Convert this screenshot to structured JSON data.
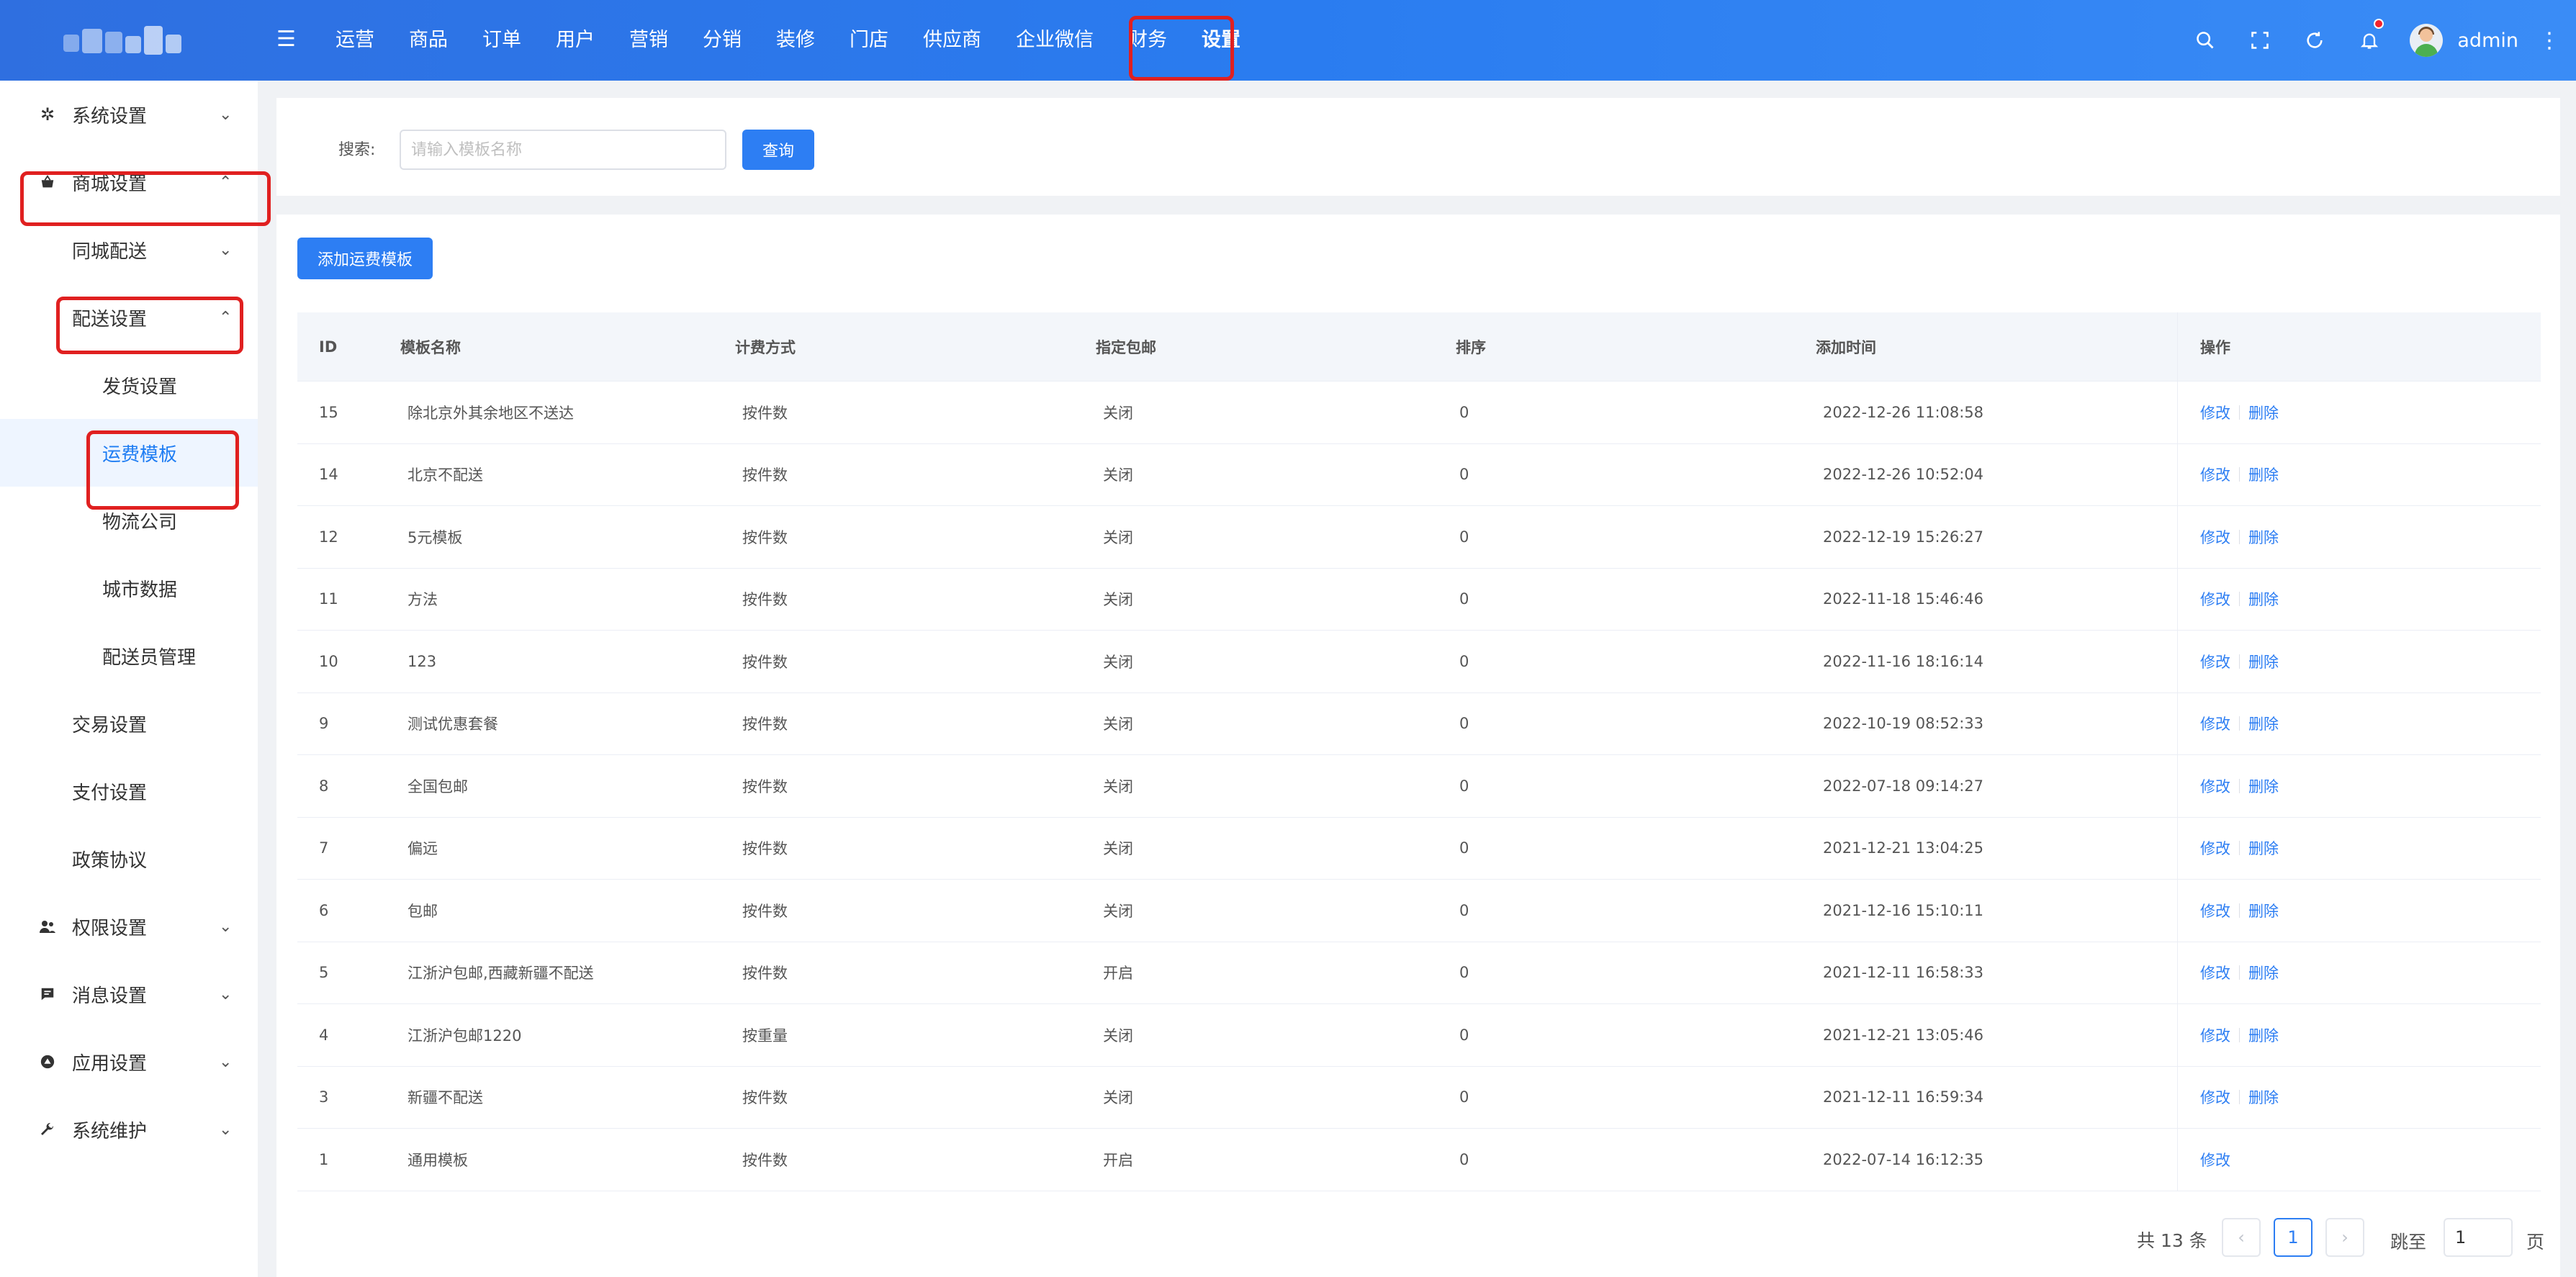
{
  "header": {
    "nav": [
      "运营",
      "商品",
      "订单",
      "用户",
      "营销",
      "分销",
      "装修",
      "门店",
      "供应商",
      "企业微信",
      "财务",
      "设置"
    ],
    "active_nav": "设置",
    "user": "admin"
  },
  "sidebar": {
    "system_settings": "系统设置",
    "mall_settings": "商城设置",
    "same_city_delivery": "同城配送",
    "delivery_settings": "配送设置",
    "shipping_settings": "发货设置",
    "freight_template": "运费模板",
    "logistics_company": "物流公司",
    "city_data": "城市数据",
    "courier_management": "配送员管理",
    "trade_settings": "交易设置",
    "payment_settings": "支付设置",
    "policy_agreement": "政策协议",
    "permission_settings": "权限设置",
    "message_settings": "消息设置",
    "app_settings": "应用设置",
    "system_maintenance": "系统维护"
  },
  "search": {
    "label": "搜索:",
    "placeholder": "请输入模板名称",
    "value": "",
    "button": "查询"
  },
  "toolbar": {
    "add_button": "添加运费模板"
  },
  "table": {
    "columns": {
      "id": "ID",
      "name": "模板名称",
      "billing": "计费方式",
      "free_shipping": "指定包邮",
      "sort": "排序",
      "created": "添加时间",
      "actions": "操作"
    },
    "edit_label": "修改",
    "delete_label": "删除",
    "rows": [
      {
        "id": "15",
        "name": "除北京外其余地区不送达",
        "billing": "按件数",
        "free": "关闭",
        "sort": "0",
        "time": "2022-12-26 11:08:58"
      },
      {
        "id": "14",
        "name": "北京不配送",
        "billing": "按件数",
        "free": "关闭",
        "sort": "0",
        "time": "2022-12-26 10:52:04"
      },
      {
        "id": "12",
        "name": "5元模板",
        "billing": "按件数",
        "free": "关闭",
        "sort": "0",
        "time": "2022-12-19 15:26:27"
      },
      {
        "id": "11",
        "name": "方法",
        "billing": "按件数",
        "free": "关闭",
        "sort": "0",
        "time": "2022-11-18 15:46:46"
      },
      {
        "id": "10",
        "name": "123",
        "billing": "按件数",
        "free": "关闭",
        "sort": "0",
        "time": "2022-11-16 18:16:14"
      },
      {
        "id": "9",
        "name": "测试优惠套餐",
        "billing": "按件数",
        "free": "关闭",
        "sort": "0",
        "time": "2022-10-19 08:52:33"
      },
      {
        "id": "8",
        "name": "全国包邮",
        "billing": "按件数",
        "free": "关闭",
        "sort": "0",
        "time": "2022-07-18 09:14:27"
      },
      {
        "id": "7",
        "name": "偏远",
        "billing": "按件数",
        "free": "关闭",
        "sort": "0",
        "time": "2021-12-21 13:04:25"
      },
      {
        "id": "6",
        "name": "包邮",
        "billing": "按件数",
        "free": "关闭",
        "sort": "0",
        "time": "2021-12-16 15:10:11"
      },
      {
        "id": "5",
        "name": "江浙沪包邮,西藏新疆不配送",
        "billing": "按件数",
        "free": "开启",
        "sort": "0",
        "time": "2021-12-11 16:58:33"
      },
      {
        "id": "4",
        "name": "江浙沪包邮1220",
        "billing": "按重量",
        "free": "关闭",
        "sort": "0",
        "time": "2021-12-21 13:05:46"
      },
      {
        "id": "3",
        "name": "新疆不配送",
        "billing": "按件数",
        "free": "关闭",
        "sort": "0",
        "time": "2021-12-11 16:59:34"
      },
      {
        "id": "1",
        "name": "通用模板",
        "billing": "按件数",
        "free": "开启",
        "sort": "0",
        "time": "2022-07-14 16:12:35",
        "no_delete": true
      }
    ]
  },
  "pagination": {
    "total": "共 13 条",
    "current": "1",
    "jump_label": "跳至",
    "jump_value": "1",
    "page_label": "页"
  }
}
